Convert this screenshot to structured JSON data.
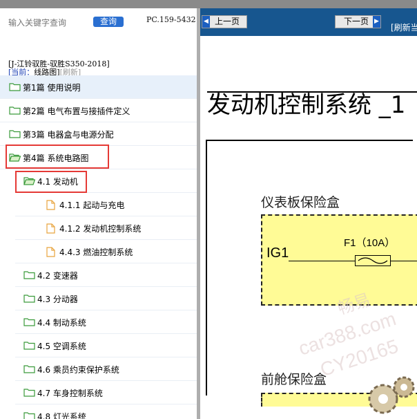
{
  "search": {
    "placeholder": "输入关键字查询",
    "button_label": "查询",
    "code": "PC.159-5432"
  },
  "book": {
    "title": "[J-江铃驭胜-驭胜S350-2018]",
    "current_prefix": "[当前：",
    "current_label": "线路图]",
    "refresh_label": "[刷新]"
  },
  "tree": [
    {
      "label": "第1篇 使用说明",
      "icon": "folder-icon"
    },
    {
      "label": "第2篇 电气布置与接插件定义",
      "icon": "folder-icon"
    },
    {
      "label": "第3篇 电器盒与电源分配",
      "icon": "folder-icon"
    },
    {
      "label": "第4篇 系统电路图",
      "icon": "folder-open-icon"
    },
    {
      "label": "4.1 发动机",
      "icon": "folder-open-icon"
    },
    {
      "label": "4.1.1 起动与充电",
      "icon": "document-icon"
    },
    {
      "label": "4.1.2 发动机控制系统",
      "icon": "document-icon"
    },
    {
      "label": "4.4.3 燃油控制系统",
      "icon": "document-icon"
    },
    {
      "label": "4.2 变速器",
      "icon": "folder-icon"
    },
    {
      "label": "4.3 分动器",
      "icon": "folder-icon"
    },
    {
      "label": "4.4 制动系统",
      "icon": "folder-icon"
    },
    {
      "label": "4.5 空调系统",
      "icon": "folder-icon"
    },
    {
      "label": "4.6 乘员约束保护系统",
      "icon": "folder-icon"
    },
    {
      "label": "4.7 车身控制系统",
      "icon": "folder-icon"
    },
    {
      "label": "4.8 灯光系统",
      "icon": "folder-icon"
    }
  ],
  "nav": {
    "prev_label": "上一页",
    "next_label": "下一页",
    "refresh_label": "[刷新当"
  },
  "doc": {
    "title": "发动机控制系统 _1",
    "section1": "仪表板保险盒",
    "ig1": "IG1",
    "fuse_label": "F1（10A）",
    "section2": "前舱保险盒",
    "watermark1": "畅易",
    "watermark2": "car388.com",
    "watermark3": "CY20165"
  },
  "colors": {
    "nav_bg": "#17568f",
    "button_blue": "#2a6fd1",
    "highlight_red": "#e53935",
    "fuse_box_yellow": "#fffb96"
  }
}
